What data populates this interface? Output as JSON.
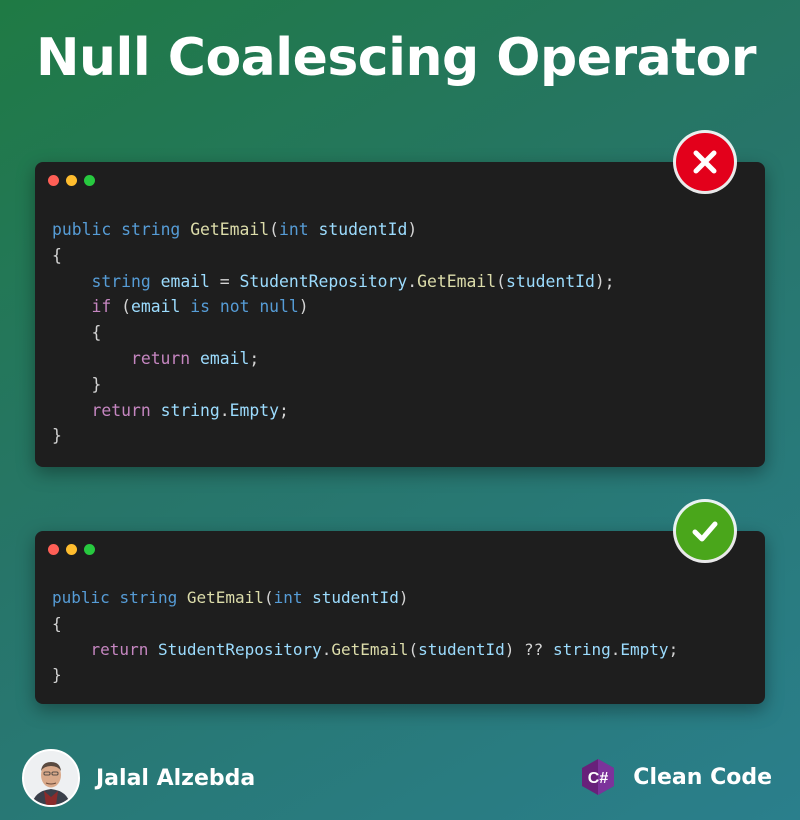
{
  "title": "Null Coalescing Operator",
  "colors": {
    "bad_badge": "#e3001b",
    "good_badge": "#4aa61b",
    "window_dot_red": "#ff5f56",
    "window_dot_yellow": "#ffbd2e",
    "window_dot_green": "#27c93f",
    "code_keyword": "#569cd6",
    "code_control": "#c586c0",
    "code_function": "#dcdcaa",
    "code_identifier": "#9cdcfe",
    "code_default": "#d4d4d4"
  },
  "bad_example": {
    "status_icon": "x-mark-icon",
    "lines": [
      [
        {
          "t": "public",
          "c": "kw"
        },
        {
          "t": " "
        },
        {
          "t": "string",
          "c": "kw"
        },
        {
          "t": " "
        },
        {
          "t": "GetEmail",
          "c": "fn"
        },
        {
          "t": "("
        },
        {
          "t": "int",
          "c": "kw"
        },
        {
          "t": " "
        },
        {
          "t": "studentId",
          "c": "id"
        },
        {
          "t": ")"
        }
      ],
      [
        {
          "t": "{"
        }
      ],
      [
        {
          "t": "    "
        },
        {
          "t": "string",
          "c": "kw"
        },
        {
          "t": " "
        },
        {
          "t": "email",
          "c": "id"
        },
        {
          "t": " = "
        },
        {
          "t": "StudentRepository",
          "c": "id"
        },
        {
          "t": "."
        },
        {
          "t": "GetEmail",
          "c": "fn"
        },
        {
          "t": "("
        },
        {
          "t": "studentId",
          "c": "id"
        },
        {
          "t": ");"
        }
      ],
      [
        {
          "t": "    "
        },
        {
          "t": "if",
          "c": "ctl"
        },
        {
          "t": " ("
        },
        {
          "t": "email",
          "c": "id"
        },
        {
          "t": " "
        },
        {
          "t": "is",
          "c": "kw"
        },
        {
          "t": " "
        },
        {
          "t": "not",
          "c": "kw"
        },
        {
          "t": " "
        },
        {
          "t": "null",
          "c": "kw"
        },
        {
          "t": ")"
        }
      ],
      [
        {
          "t": "    {"
        }
      ],
      [
        {
          "t": "        "
        },
        {
          "t": "return",
          "c": "ctl"
        },
        {
          "t": " "
        },
        {
          "t": "email",
          "c": "id"
        },
        {
          "t": ";"
        }
      ],
      [
        {
          "t": "    }"
        }
      ],
      [
        {
          "t": "    "
        },
        {
          "t": "return",
          "c": "ctl"
        },
        {
          "t": " "
        },
        {
          "t": "string",
          "c": "id"
        },
        {
          "t": "."
        },
        {
          "t": "Empty",
          "c": "id"
        },
        {
          "t": ";"
        }
      ],
      [
        {
          "t": "}"
        }
      ]
    ]
  },
  "good_example": {
    "status_icon": "check-mark-icon",
    "lines": [
      [
        {
          "t": "public",
          "c": "kw"
        },
        {
          "t": " "
        },
        {
          "t": "string",
          "c": "kw"
        },
        {
          "t": " "
        },
        {
          "t": "GetEmail",
          "c": "fn"
        },
        {
          "t": "("
        },
        {
          "t": "int",
          "c": "kw"
        },
        {
          "t": " "
        },
        {
          "t": "studentId",
          "c": "id"
        },
        {
          "t": ")"
        }
      ],
      [
        {
          "t": "{"
        }
      ],
      [
        {
          "t": "    "
        },
        {
          "t": "return",
          "c": "ctl"
        },
        {
          "t": " "
        },
        {
          "t": "StudentRepository",
          "c": "id"
        },
        {
          "t": "."
        },
        {
          "t": "GetEmail",
          "c": "fn"
        },
        {
          "t": "("
        },
        {
          "t": "studentId",
          "c": "id"
        },
        {
          "t": ") ?? "
        },
        {
          "t": "string",
          "c": "id"
        },
        {
          "t": "."
        },
        {
          "t": "Empty",
          "c": "id"
        },
        {
          "t": ";"
        }
      ],
      [
        {
          "t": "}"
        }
      ]
    ]
  },
  "author": {
    "name": "Jalal Alzebda",
    "avatar_icon": "author-avatar"
  },
  "brand": {
    "logo_text": "C#",
    "label": "Clean Code"
  }
}
